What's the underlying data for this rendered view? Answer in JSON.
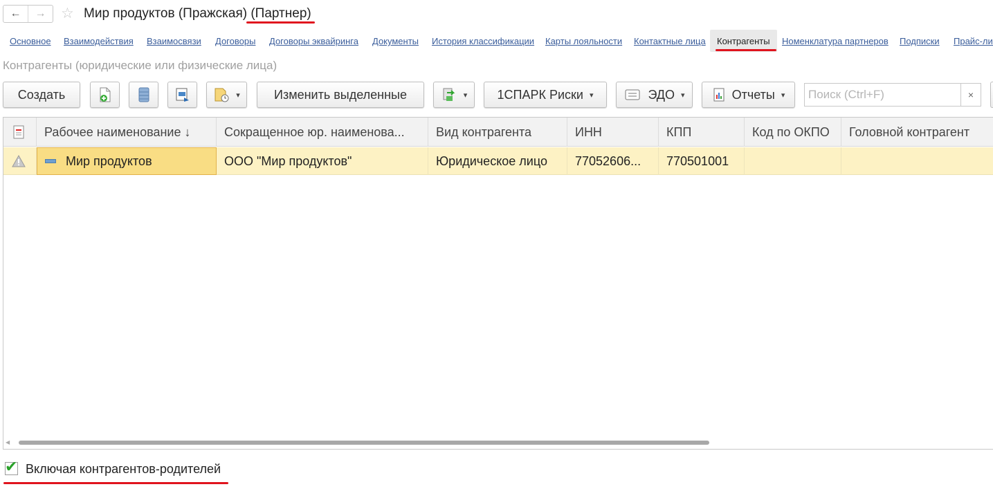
{
  "window": {
    "title": "Мир продуктов (Пражская)",
    "title_suffix": "(Партнер)",
    "back_icon": "←",
    "forward_icon": "→",
    "star_icon": "☆"
  },
  "tabs": [
    {
      "label": "Основное"
    },
    {
      "label": "Взаимодействия"
    },
    {
      "label": "Взаимосвязи"
    },
    {
      "label": "Договоры"
    },
    {
      "label": "Договоры эквайринга"
    },
    {
      "label": "Документы"
    },
    {
      "label": "История классификации"
    },
    {
      "label": "Карты лояльности"
    },
    {
      "label": "Контактные лица"
    },
    {
      "label": "Контрагенты",
      "active": true
    },
    {
      "label": "Номенклатура партнеров"
    },
    {
      "label": "Подписки"
    },
    {
      "label": "Прайс-лис"
    }
  ],
  "section_title": "Контрагенты (юридические или физические лица)",
  "toolbar": {
    "create_label": "Создать",
    "edit_selected_label": "Изменить выделенные",
    "spark_label": "1СПАРК Риски",
    "edo_label": "ЭДО",
    "reports_label": "Отчеты",
    "search_placeholder": "Поиск (Ctrl+F)",
    "clear_icon": "×",
    "caret": "▾"
  },
  "table": {
    "columns": [
      "Рабочее наименование  ↓",
      "Сокращенное юр. наименова...",
      "Вид контрагента",
      "ИНН",
      "КПП",
      "Код по ОКПО",
      "Головной контрагент"
    ],
    "rows": [
      {
        "status_icon": "warning-icon",
        "name": "Мир продуктов",
        "short_name": "ООО \"Мир продуктов\"",
        "kind": "Юридическое лицо",
        "inn": "77052606...",
        "kpp": "770501001",
        "okpo": "",
        "head": ""
      }
    ]
  },
  "footer": {
    "include_parents_label": "Включая контрагентов-родителей",
    "include_parents_checked": true,
    "check_glyph": "✔"
  },
  "colors": {
    "accent_underline": "#e0141e",
    "link": "#3a5d9b",
    "row_selected": "#fdf2c4",
    "cell_focus": "#f9dd84"
  }
}
